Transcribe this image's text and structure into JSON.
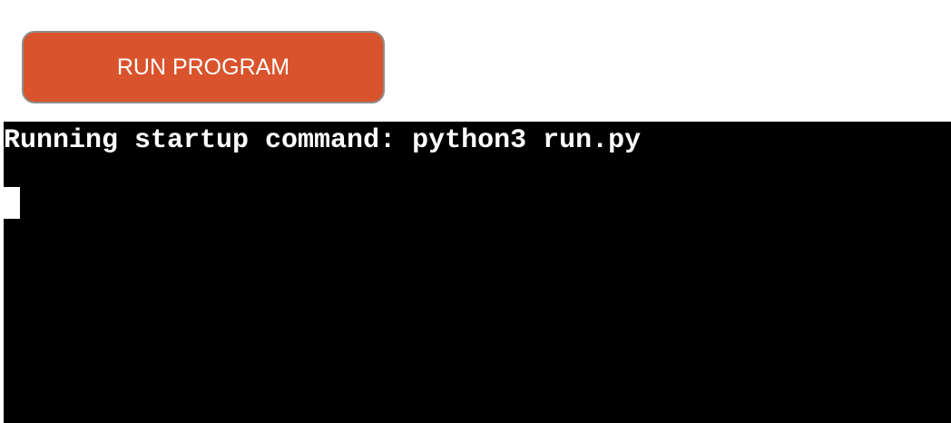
{
  "toolbar": {
    "run_label": "RUN PROGRAM"
  },
  "terminal": {
    "lines": [
      "Running startup command: python3 run.py"
    ]
  },
  "colors": {
    "button_bg": "#d9532c",
    "button_border": "#8e8e8e",
    "terminal_bg": "#000000",
    "terminal_fg": "#ffffff"
  }
}
